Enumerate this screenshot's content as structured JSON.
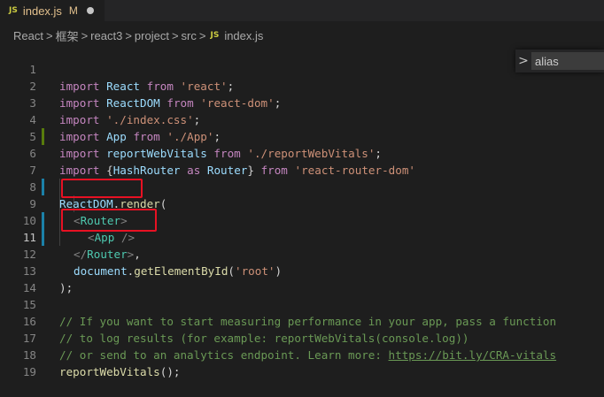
{
  "tab": {
    "icon": "JS",
    "title": "index.js",
    "modified": "M"
  },
  "breadcrumb": {
    "items": [
      "React",
      "框架",
      "react3",
      "project",
      "src"
    ],
    "file_icon": "JS",
    "file": "index.js",
    "separator": ">"
  },
  "find_widget": {
    "chevron": ">",
    "value": "alias"
  },
  "line_numbers": [
    "1",
    "2",
    "3",
    "4",
    "5",
    "6",
    "7",
    "8",
    "9",
    "10",
    "11",
    "12",
    "13",
    "14",
    "15",
    "16",
    "17",
    "18",
    "19"
  ],
  "code": {
    "l1": {
      "kw1": "import",
      "id": "React",
      "kw2": "from",
      "str": "'react'",
      "end": ";"
    },
    "l2": {
      "kw1": "import",
      "id": "ReactDOM",
      "kw2": "from",
      "str": "'react-dom'",
      "end": ";"
    },
    "l3": {
      "kw1": "import",
      "str": "'./index.css'",
      "end": ";"
    },
    "l4": {
      "kw1": "import",
      "id": "App",
      "kw2": "from",
      "str": "'./App'",
      "end": ";"
    },
    "l5": {
      "kw1": "import",
      "id": "reportWebVitals",
      "kw2": "from",
      "str": "'./reportWebVitals'",
      "end": ";"
    },
    "l6": {
      "kw1": "import",
      "open": "{",
      "id1": "HashRouter",
      "kw_as": "as",
      "id2": "Router",
      "close": "}",
      "kw2": "from",
      "str": "'react-router-dom'"
    },
    "l8": {
      "obj": "ReactDOM",
      "dot": ".",
      "fn": "render",
      "paren": "("
    },
    "l9": {
      "lt": "<",
      "tag": "Router",
      "gt": ">"
    },
    "l10": {
      "lt": "<",
      "tag": "App",
      "end": " />"
    },
    "l11": {
      "lt": "</",
      "tag": "Router",
      "gt": ">",
      "comma": ","
    },
    "l12": {
      "obj": "document",
      "dot": ".",
      "fn": "getElementById",
      "open": "(",
      "str": "'root'",
      "close": ")"
    },
    "l13": {
      "text": ");"
    },
    "l15": {
      "text": "// If you want to start measuring performance in your app, pass a function"
    },
    "l16": {
      "text": "// to log results (for example: reportWebVitals(console.log))"
    },
    "l17": {
      "text": "// or send to an analytics endpoint. Learn more: ",
      "link": "https://bit.ly/CRA-vitals"
    },
    "l18": {
      "fn": "reportWebVitals",
      "rest": "();"
    }
  },
  "colors": {
    "background": "#1e1e1e",
    "keyword": "#c586c0",
    "identifier": "#9cdcfe",
    "string": "#ce9178",
    "function": "#dcdcaa",
    "tag": "#4ec9b0",
    "comment": "#6a9955",
    "highlight_box": "#e81123",
    "gutter_modified": "#1b81a8",
    "gutter_added": "#587c0c"
  }
}
